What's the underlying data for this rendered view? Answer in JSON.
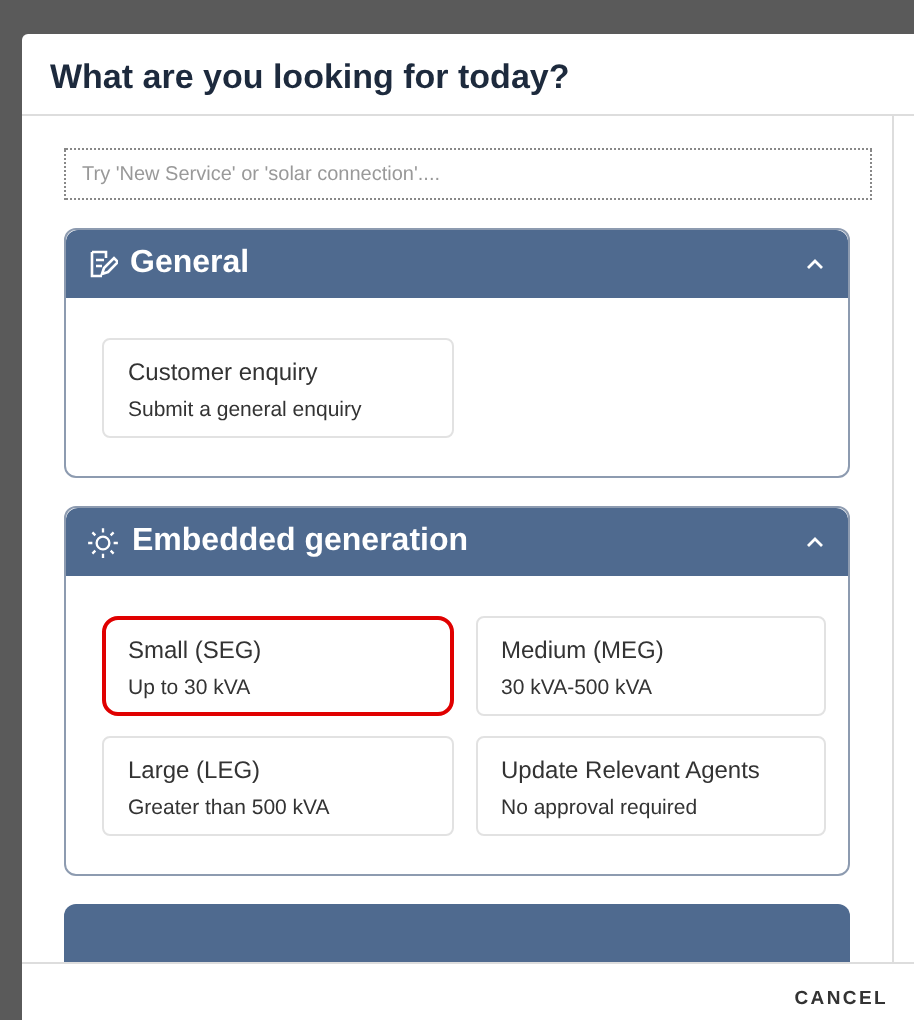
{
  "dialog": {
    "title": "What are you looking for today?"
  },
  "search": {
    "placeholder": "Try 'New Service' or 'solar connection'...."
  },
  "sections": [
    {
      "title": "General",
      "expanded": true,
      "items": [
        {
          "title": "Customer enquiry",
          "subtitle": "Submit a general enquiry",
          "highlighted": false
        }
      ]
    },
    {
      "title": "Embedded generation",
      "expanded": true,
      "items": [
        {
          "title": "Small (SEG)",
          "subtitle": "Up to 30 kVA",
          "highlighted": true
        },
        {
          "title": "Medium (MEG)",
          "subtitle": "30 kVA-500 kVA",
          "highlighted": false
        },
        {
          "title": "Large (LEG)",
          "subtitle": "Greater than 500 kVA",
          "highlighted": false
        },
        {
          "title": "Update Relevant Agents",
          "subtitle": "No approval required",
          "highlighted": false
        }
      ]
    }
  ],
  "footer": {
    "cancel": "CANCEL"
  }
}
